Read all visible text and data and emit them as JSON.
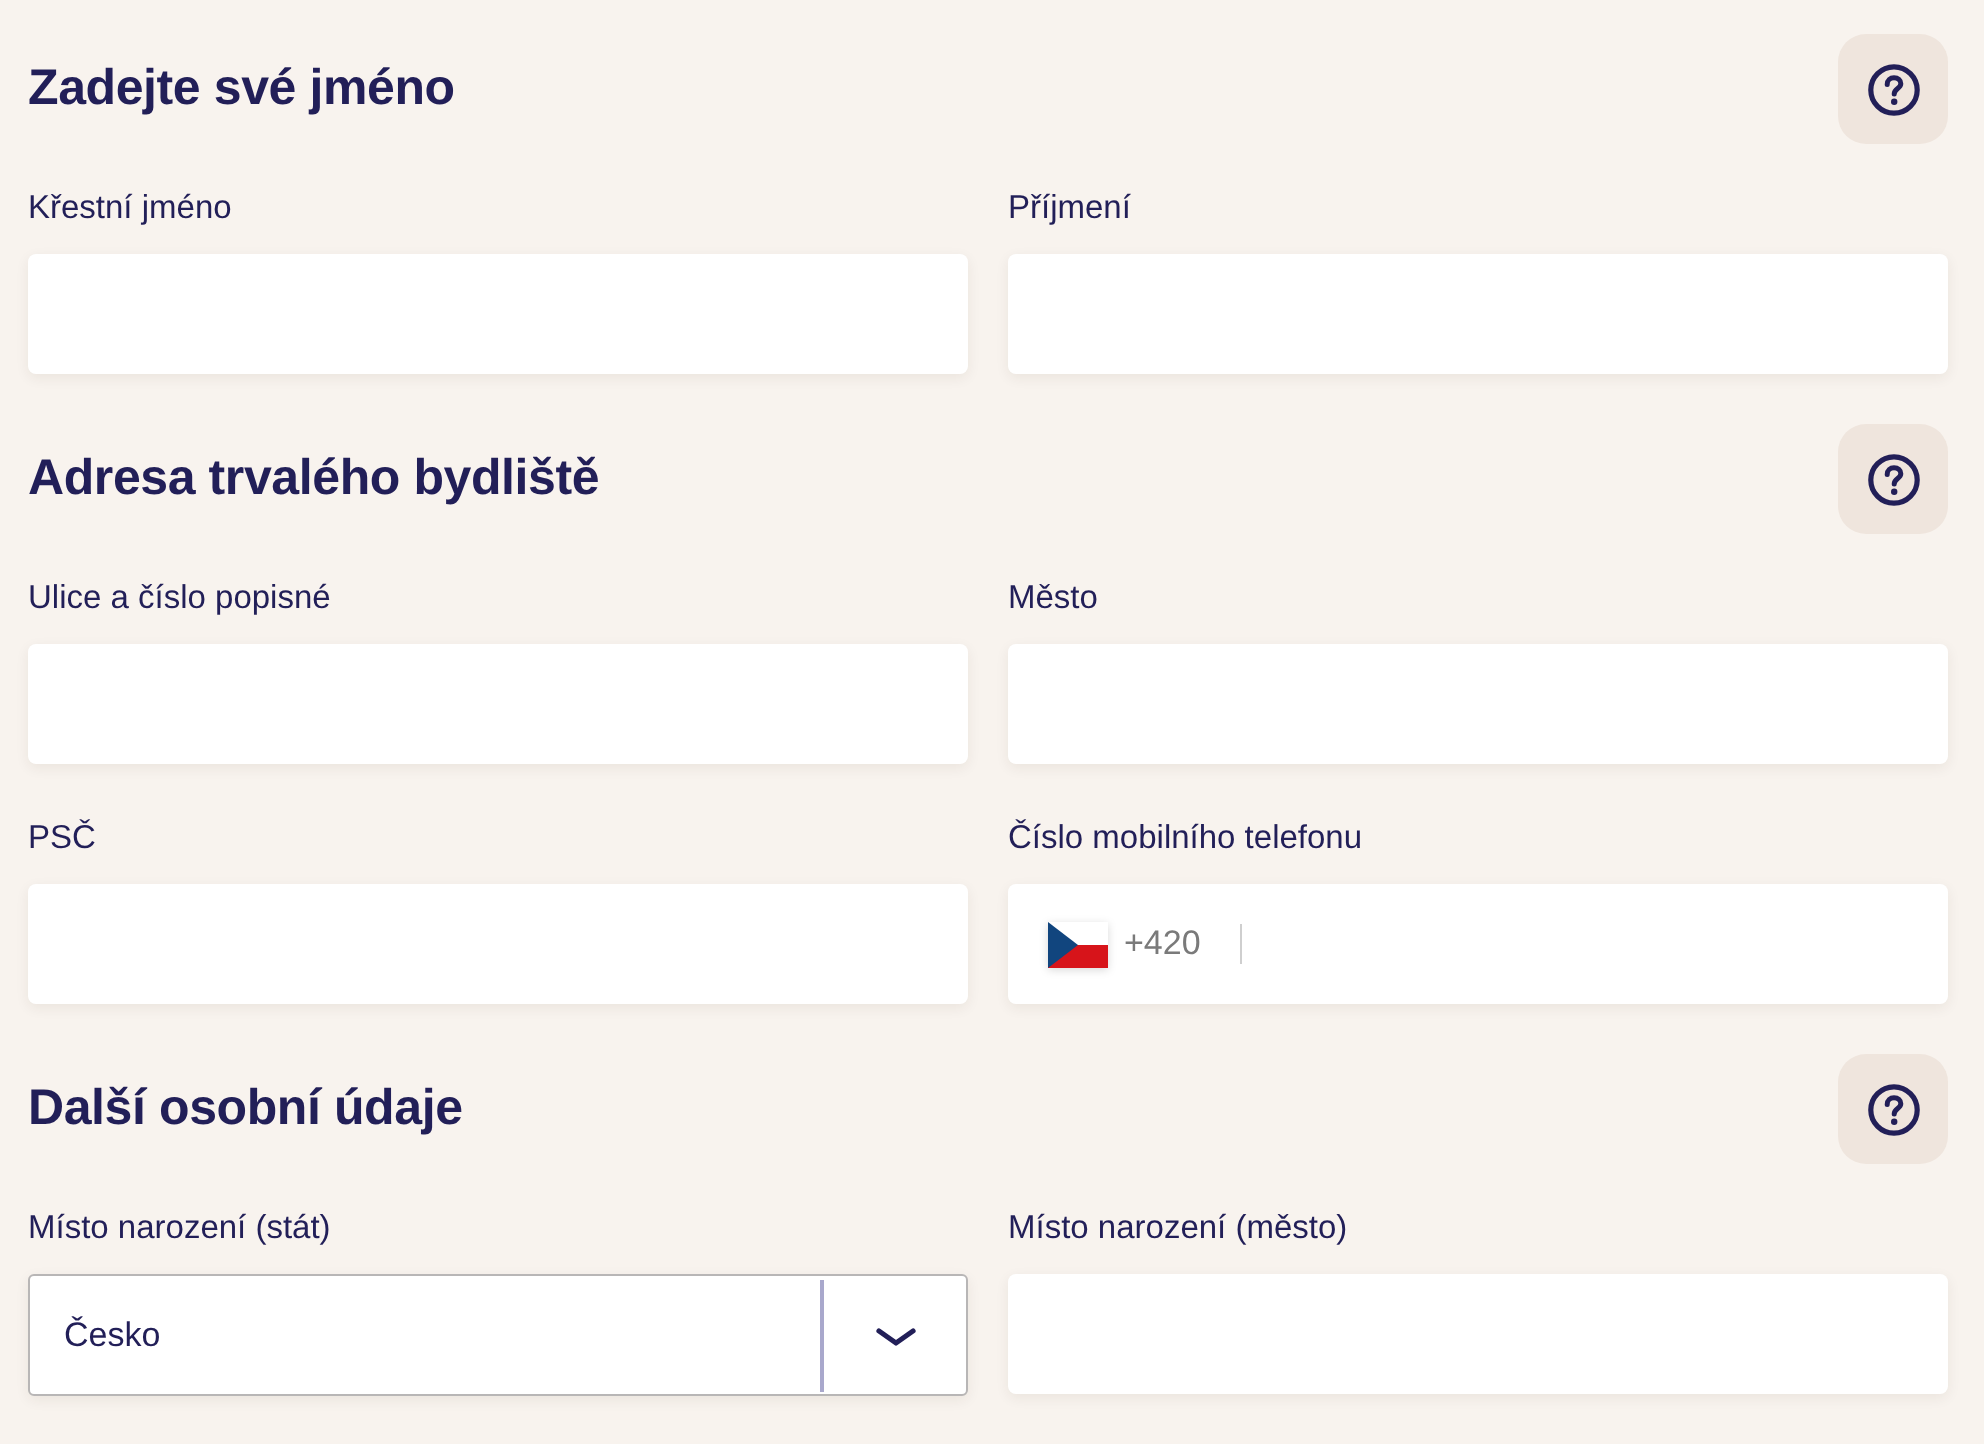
{
  "sections": [
    {
      "title": "Zadejte své jméno",
      "fields": [
        {
          "kind": "text",
          "label": "Křestní jméno"
        },
        {
          "kind": "text",
          "label": "Příjmení"
        }
      ]
    },
    {
      "title": "Adresa trvalého bydliště",
      "fields": [
        {
          "kind": "text",
          "label": "Ulice a číslo popisné"
        },
        {
          "kind": "text",
          "label": "Město"
        },
        {
          "kind": "text",
          "label": "PSČ"
        },
        {
          "kind": "phone",
          "label": "Číslo mobilního telefonu",
          "prefix": "+420"
        }
      ]
    },
    {
      "title": "Další osobní údaje",
      "fields": [
        {
          "kind": "select",
          "label": "Místo narození (stát)",
          "value": "Česko"
        },
        {
          "kind": "text",
          "label": "Místo narození (město)"
        }
      ]
    }
  ]
}
